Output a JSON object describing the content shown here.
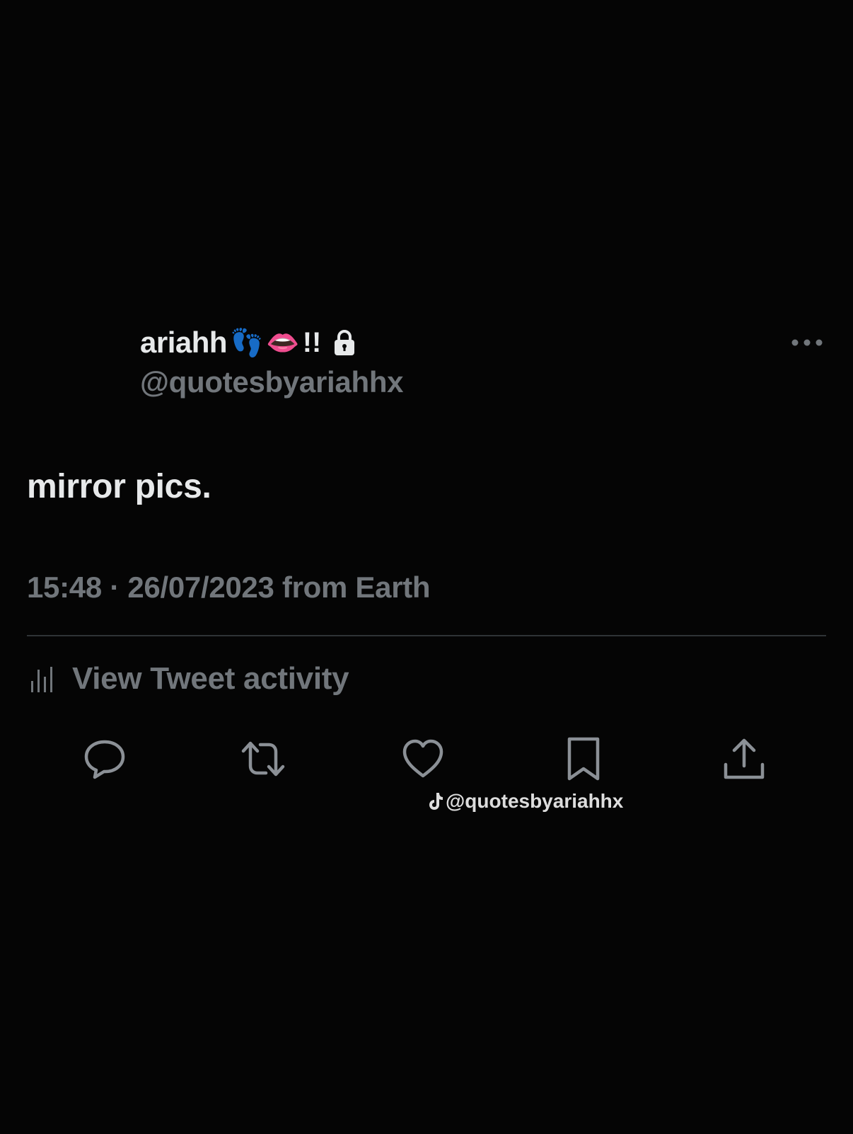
{
  "author": {
    "display_name": "ariahh",
    "emoji_feet": "👣",
    "emoji_lips": "👄",
    "bangs": "!!",
    "protected_icon": "lock-icon",
    "handle": "@quotesbyariahhx"
  },
  "menu": {
    "icon": "more-dots-icon"
  },
  "tweet": {
    "text": "mirror pics.",
    "timestamp": "15:48 · 26/07/2023 from Earth"
  },
  "activity": {
    "icon": "bar-chart-icon",
    "label": "View Tweet activity"
  },
  "actions": [
    {
      "icon": "reply-icon"
    },
    {
      "icon": "retweet-icon"
    },
    {
      "icon": "like-icon"
    },
    {
      "icon": "bookmark-icon"
    },
    {
      "icon": "share-icon"
    }
  ],
  "watermark": {
    "icon": "tiktok-icon",
    "text": "@quotesbyariahhx"
  },
  "colors": {
    "background": "#050505",
    "primary_text": "#e7e9ea",
    "secondary_text": "#71767b",
    "divider": "#2f3336"
  }
}
